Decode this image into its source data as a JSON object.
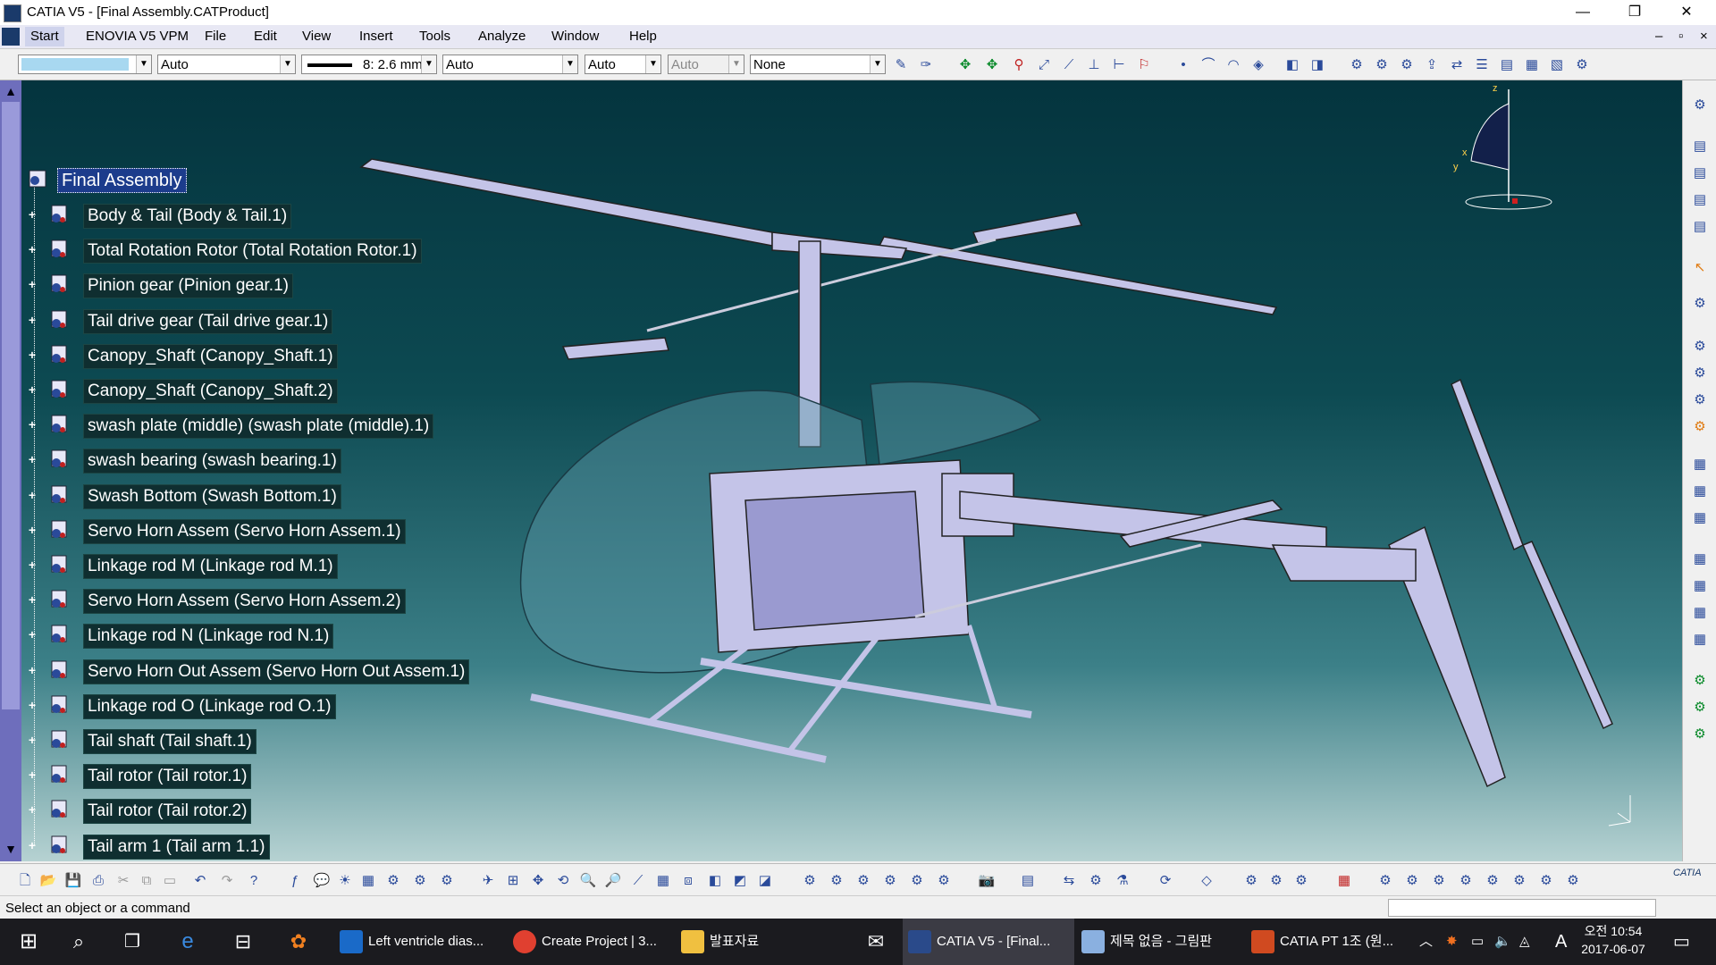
{
  "window": {
    "title": "CATIA V5 - [Final Assembly.CATProduct]",
    "minimize": "—",
    "restore": "❐",
    "close": "✕",
    "doc_min": "–",
    "doc_restore": "▫",
    "doc_close": "×"
  },
  "menu": {
    "items": [
      "Start",
      "ENOVIA V5 VPM",
      "File",
      "Edit",
      "View",
      "Insert",
      "Tools",
      "Analyze",
      "Window",
      "Help"
    ]
  },
  "toolbar": {
    "color_value": "",
    "transparency_value": "Auto",
    "linetype_value": "8: 2.6 mm",
    "lineweight_value": "Auto",
    "point_value": "Auto",
    "layer_value": "Auto",
    "render_value": "None"
  },
  "tree": {
    "root": "Final Assembly",
    "items": [
      "Body & Tail (Body & Tail.1)",
      "Total Rotation Rotor (Total Rotation Rotor.1)",
      "Pinion gear (Pinion gear.1)",
      "Tail drive gear (Tail drive gear.1)",
      "Canopy_Shaft (Canopy_Shaft.1)",
      "Canopy_Shaft (Canopy_Shaft.2)",
      "swash plate (middle) (swash plate (middle).1)",
      "swash bearing (swash bearing.1)",
      "Swash Bottom (Swash Bottom.1)",
      "Servo Horn Assem (Servo Horn Assem.1)",
      "Linkage rod M (Linkage rod M.1)",
      "Servo Horn Assem (Servo Horn Assem.2)",
      "Linkage rod N (Linkage rod N.1)",
      "Servo Horn Out Assem (Servo Horn Out Assem.1)",
      "Linkage rod O (Linkage rod O.1)",
      "Tail shaft (Tail shaft.1)",
      "Tail rotor (Tail rotor.1)",
      "Tail rotor (Tail rotor.2)",
      "Tail arm 1 (Tail arm 1.1)"
    ]
  },
  "compass": {
    "x": "x",
    "y": "y",
    "z": "z"
  },
  "status": {
    "message": "Select an object or a command"
  },
  "catia_logo": "CATIA",
  "taskbar": {
    "tasks": [
      "Left ventricle dias...",
      "Create Project | 3...",
      "발표자료",
      "CATIA V5 - [Final...",
      "제목 없음 - 그림판",
      "CATIA PT 1조 (원..."
    ],
    "clock_time": "오전 10:54",
    "clock_date": "2017-06-07",
    "ime": "A"
  },
  "colors": {
    "accent": "#1c3c8c",
    "viewport_top": "#04343e",
    "taskbar": "#1b1b1f"
  }
}
